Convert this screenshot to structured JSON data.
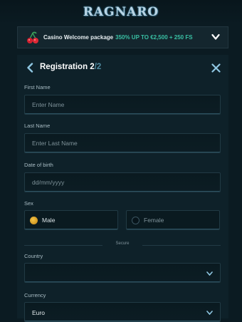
{
  "brand": {
    "logo_text": "RAGNARO"
  },
  "promo": {
    "label": "Casino Welcome package",
    "highlight": "350% UP TO €2,500 + 250 FS"
  },
  "header": {
    "title": "Registration 2",
    "step_of": "/2"
  },
  "form": {
    "first_name": {
      "label": "First Name",
      "placeholder": "Enter Name"
    },
    "last_name": {
      "label": "Last Name",
      "placeholder": "Enter Last Name"
    },
    "dob": {
      "label": "Date of birth",
      "placeholder": "dd/mm/yyyy"
    },
    "sex": {
      "label": "Sex",
      "options": [
        {
          "label": "Male",
          "selected": true
        },
        {
          "label": "Female",
          "selected": false
        }
      ]
    },
    "secure_label": "Secure",
    "country": {
      "label": "Country",
      "value": ""
    },
    "currency": {
      "label": "Currency",
      "value": "Euro"
    }
  },
  "colors": {
    "accent": "#39c0a4",
    "radio_on": "#f5c446",
    "background": "#0b1b22"
  }
}
